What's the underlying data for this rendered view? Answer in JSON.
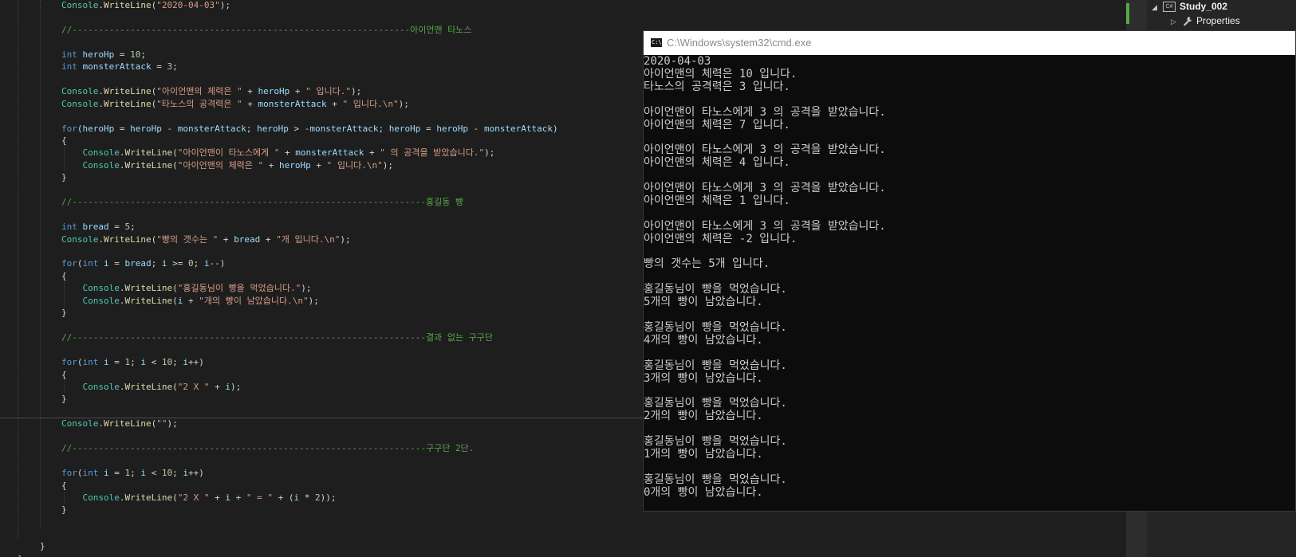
{
  "editor": {
    "lines": [
      [
        [
          "Console",
          "type"
        ],
        [
          ".",
          "text"
        ],
        [
          "WriteLine",
          "method"
        ],
        [
          "(",
          "text"
        ],
        [
          "\"2020-04-03\"",
          "str"
        ],
        [
          ");",
          "text"
        ]
      ],
      [],
      [
        [
          "//----------------------------------------------------------------아이언맨 타노스",
          "com"
        ]
      ],
      [],
      [
        [
          "int",
          "kw"
        ],
        [
          " ",
          "text"
        ],
        [
          "heroHp",
          "var"
        ],
        [
          " = ",
          "text"
        ],
        [
          "10",
          "num"
        ],
        [
          ";",
          "text"
        ]
      ],
      [
        [
          "int",
          "kw"
        ],
        [
          " ",
          "text"
        ],
        [
          "monsterAttack",
          "var"
        ],
        [
          " = ",
          "text"
        ],
        [
          "3",
          "num"
        ],
        [
          ";",
          "text"
        ]
      ],
      [],
      [
        [
          "Console",
          "type"
        ],
        [
          ".",
          "text"
        ],
        [
          "WriteLine",
          "method"
        ],
        [
          "(",
          "text"
        ],
        [
          "\"아이언맨의 체력은 \"",
          "str"
        ],
        [
          " + ",
          "text"
        ],
        [
          "heroHp",
          "var"
        ],
        [
          " + ",
          "text"
        ],
        [
          "\" 입니다.\"",
          "str"
        ],
        [
          ");",
          "text"
        ]
      ],
      [
        [
          "Console",
          "type"
        ],
        [
          ".",
          "text"
        ],
        [
          "WriteLine",
          "method"
        ],
        [
          "(",
          "text"
        ],
        [
          "\"타노스의 공격력은 \"",
          "str"
        ],
        [
          " + ",
          "text"
        ],
        [
          "monsterAttack",
          "var"
        ],
        [
          " + ",
          "text"
        ],
        [
          "\" 입니다.\\n\"",
          "str"
        ],
        [
          ");",
          "text"
        ]
      ],
      [],
      [
        [
          "for",
          "kw"
        ],
        [
          "(",
          "text"
        ],
        [
          "heroHp",
          "var"
        ],
        [
          " = ",
          "text"
        ],
        [
          "heroHp",
          "var"
        ],
        [
          " - ",
          "text"
        ],
        [
          "monsterAttack",
          "var"
        ],
        [
          "; ",
          "text"
        ],
        [
          "heroHp",
          "var"
        ],
        [
          " > -",
          "text"
        ],
        [
          "monsterAttack",
          "var"
        ],
        [
          "; ",
          "text"
        ],
        [
          "heroHp",
          "var"
        ],
        [
          " = ",
          "text"
        ],
        [
          "heroHp",
          "var"
        ],
        [
          " - ",
          "text"
        ],
        [
          "monsterAttack",
          "var"
        ],
        [
          ")",
          "text"
        ]
      ],
      [
        [
          "{",
          "text"
        ]
      ],
      [
        [
          "    ",
          "text"
        ],
        [
          "Console",
          "type"
        ],
        [
          ".",
          "text"
        ],
        [
          "WriteLine",
          "method"
        ],
        [
          "(",
          "text"
        ],
        [
          "\"아이언맨이 타노스에게 \"",
          "str"
        ],
        [
          " + ",
          "text"
        ],
        [
          "monsterAttack",
          "var"
        ],
        [
          " + ",
          "text"
        ],
        [
          "\" 의 공격을 받았습니다.\"",
          "str"
        ],
        [
          ");",
          "text"
        ]
      ],
      [
        [
          "    ",
          "text"
        ],
        [
          "Console",
          "type"
        ],
        [
          ".",
          "text"
        ],
        [
          "WriteLine",
          "method"
        ],
        [
          "(",
          "text"
        ],
        [
          "\"아이언맨의 체력은 \"",
          "str"
        ],
        [
          " + ",
          "text"
        ],
        [
          "heroHp",
          "var"
        ],
        [
          " + ",
          "text"
        ],
        [
          "\" 입니다.\\n\"",
          "str"
        ],
        [
          ");",
          "text"
        ]
      ],
      [
        [
          "}",
          "text"
        ]
      ],
      [],
      [
        [
          "//-------------------------------------------------------------------홍길동 빵",
          "com"
        ]
      ],
      [],
      [
        [
          "int",
          "kw"
        ],
        [
          " ",
          "text"
        ],
        [
          "bread",
          "var"
        ],
        [
          " = ",
          "text"
        ],
        [
          "5",
          "num"
        ],
        [
          ";",
          "text"
        ]
      ],
      [
        [
          "Console",
          "type"
        ],
        [
          ".",
          "text"
        ],
        [
          "WriteLine",
          "method"
        ],
        [
          "(",
          "text"
        ],
        [
          "\"빵의 갯수는 \"",
          "str"
        ],
        [
          " + ",
          "text"
        ],
        [
          "bread",
          "var"
        ],
        [
          " + ",
          "text"
        ],
        [
          "\"개 입니다.\\n\"",
          "str"
        ],
        [
          ");",
          "text"
        ]
      ],
      [],
      [
        [
          "for",
          "kw"
        ],
        [
          "(",
          "text"
        ],
        [
          "int",
          "kw"
        ],
        [
          " ",
          "text"
        ],
        [
          "i",
          "var"
        ],
        [
          " = ",
          "text"
        ],
        [
          "bread",
          "var"
        ],
        [
          "; ",
          "text"
        ],
        [
          "i",
          "var"
        ],
        [
          " >= ",
          "text"
        ],
        [
          "0",
          "num"
        ],
        [
          "; ",
          "text"
        ],
        [
          "i",
          "var"
        ],
        [
          "--)",
          "text"
        ]
      ],
      [
        [
          "{",
          "text"
        ]
      ],
      [
        [
          "    ",
          "text"
        ],
        [
          "Console",
          "type"
        ],
        [
          ".",
          "text"
        ],
        [
          "WriteLine",
          "method"
        ],
        [
          "(",
          "text"
        ],
        [
          "\"홍길동님이 빵을 먹었습니다.\"",
          "str"
        ],
        [
          ");",
          "text"
        ]
      ],
      [
        [
          "    ",
          "text"
        ],
        [
          "Console",
          "type"
        ],
        [
          ".",
          "text"
        ],
        [
          "WriteLine",
          "method"
        ],
        [
          "(",
          "text"
        ],
        [
          "i",
          "var"
        ],
        [
          " + ",
          "text"
        ],
        [
          "\"개의 빵이 남았습니다.\\n\"",
          "str"
        ],
        [
          ");",
          "text"
        ]
      ],
      [
        [
          "}",
          "text"
        ]
      ],
      [],
      [
        [
          "//-------------------------------------------------------------------결과 없는 구구단",
          "com"
        ]
      ],
      [],
      [
        [
          "for",
          "kw"
        ],
        [
          "(",
          "text"
        ],
        [
          "int",
          "kw"
        ],
        [
          " ",
          "text"
        ],
        [
          "i",
          "var"
        ],
        [
          " = ",
          "text"
        ],
        [
          "1",
          "num"
        ],
        [
          "; ",
          "text"
        ],
        [
          "i",
          "var"
        ],
        [
          " < ",
          "text"
        ],
        [
          "10",
          "num"
        ],
        [
          "; ",
          "text"
        ],
        [
          "i",
          "var"
        ],
        [
          "++)",
          "text"
        ]
      ],
      [
        [
          "{",
          "text"
        ]
      ],
      [
        [
          "    ",
          "text"
        ],
        [
          "Console",
          "type"
        ],
        [
          ".",
          "text"
        ],
        [
          "WriteLine",
          "method"
        ],
        [
          "(",
          "text"
        ],
        [
          "\"2 X \"",
          "str"
        ],
        [
          " + ",
          "text"
        ],
        [
          "i",
          "var"
        ],
        [
          ");",
          "text"
        ]
      ],
      [
        [
          "}",
          "text"
        ]
      ],
      [],
      [
        [
          "Console",
          "type"
        ],
        [
          ".",
          "text"
        ],
        [
          "WriteLine",
          "method"
        ],
        [
          "(",
          "text"
        ],
        [
          "\"\"",
          "str"
        ],
        [
          ");",
          "text"
        ]
      ],
      [],
      [
        [
          "//-------------------------------------------------------------------구구단 2단.",
          "com"
        ]
      ],
      [],
      [
        [
          "for",
          "kw"
        ],
        [
          "(",
          "text"
        ],
        [
          "int",
          "kw"
        ],
        [
          " ",
          "text"
        ],
        [
          "i",
          "var"
        ],
        [
          " = ",
          "text"
        ],
        [
          "1",
          "num"
        ],
        [
          "; ",
          "text"
        ],
        [
          "i",
          "var"
        ],
        [
          " < ",
          "text"
        ],
        [
          "10",
          "num"
        ],
        [
          "; ",
          "text"
        ],
        [
          "i",
          "var"
        ],
        [
          "++)",
          "text"
        ]
      ],
      [
        [
          "{",
          "text"
        ]
      ],
      [
        [
          "    ",
          "text"
        ],
        [
          "Console",
          "type"
        ],
        [
          ".",
          "text"
        ],
        [
          "WriteLine",
          "method"
        ],
        [
          "(",
          "text"
        ],
        [
          "\"2 X \"",
          "str"
        ],
        [
          " + ",
          "text"
        ],
        [
          "i",
          "var"
        ],
        [
          " + ",
          "text"
        ],
        [
          "\" = \"",
          "str"
        ],
        [
          " + (",
          "text"
        ],
        [
          "i",
          "var"
        ],
        [
          " * ",
          "text"
        ],
        [
          "2",
          "num"
        ],
        [
          "));",
          "text"
        ]
      ],
      [
        [
          "}",
          "text"
        ]
      ]
    ],
    "closing_braces": [
      "}",
      "}"
    ]
  },
  "cmd": {
    "title": "C:\\Windows\\system32\\cmd.exe",
    "icon_label": "C:\\",
    "output_lines": [
      "2020-04-03",
      "아이언맨의 체력은 10 입니다.",
      "타노스의 공격력은 3 입니다.",
      "",
      "아이언맨이 타노스에게 3 의 공격을 받았습니다.",
      "아이언맨의 체력은 7 입니다.",
      "",
      "아이언맨이 타노스에게 3 의 공격을 받았습니다.",
      "아이언맨의 체력은 4 입니다.",
      "",
      "아이언맨이 타노스에게 3 의 공격을 받았습니다.",
      "아이언맨의 체력은 1 입니다.",
      "",
      "아이언맨이 타노스에게 3 의 공격을 받았습니다.",
      "아이언맨의 체력은 -2 입니다.",
      "",
      "빵의 갯수는 5개 입니다.",
      "",
      "홍길동님이 빵을 먹었습니다.",
      "5개의 빵이 남았습니다.",
      "",
      "홍길동님이 빵을 먹었습니다.",
      "4개의 빵이 남았습니다.",
      "",
      "홍길동님이 빵을 먹었습니다.",
      "3개의 빵이 남았습니다.",
      "",
      "홍길동님이 빵을 먹었습니다.",
      "2개의 빵이 남았습니다.",
      "",
      "홍길동님이 빵을 먹었습니다.",
      "1개의 빵이 남았습니다.",
      "",
      "홍길동님이 빵을 먹었습니다.",
      "0개의 빵이 남았습니다."
    ]
  },
  "solution_explorer": {
    "project_name": "Study_002",
    "project_icon_label": "C#",
    "items": [
      {
        "label": "Properties",
        "icon": "wrench-icon"
      }
    ]
  },
  "colors": {
    "editor_bg": "#1e1e1e",
    "keyword": "#569cd6",
    "type": "#4ec9b0",
    "method": "#dcdcaa",
    "variable": "#9cdcfe",
    "string": "#d69d85",
    "comment": "#57a64a",
    "number": "#b5cea8",
    "console_bg": "#0c0c0c",
    "console_text": "#cccccc"
  }
}
